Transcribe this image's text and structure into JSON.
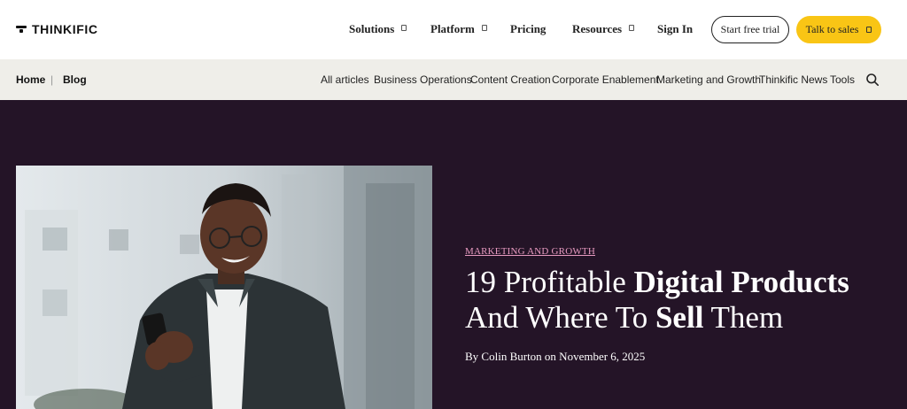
{
  "header": {
    "logo_text": "THINKIFIC",
    "nav": [
      {
        "label": "Solutions",
        "has_dropdown": true
      },
      {
        "label": "Platform",
        "has_dropdown": true
      },
      {
        "label": "Pricing",
        "has_dropdown": false
      },
      {
        "label": "Resources",
        "has_dropdown": true
      },
      {
        "label": "Sign In",
        "has_dropdown": false
      }
    ],
    "start_trial_label": "Start free trial",
    "talk_sales_label": "Talk to sales",
    "accent_color": "#f9c515"
  },
  "subnav": {
    "breadcrumb": [
      "Home",
      "Blog"
    ],
    "categories": [
      "All articles",
      "Business Operations",
      "Content Creation",
      "Corporate Enablement",
      "Marketing and Growth",
      "Thinkific News",
      "Tools"
    ],
    "search_icon": "search-icon",
    "background_color": "#efeee9"
  },
  "hero": {
    "background_color": "#241427",
    "category": "MARKETING AND GROWTH",
    "category_color": "#e79ac0",
    "title_parts": {
      "p1": "19 Profitable ",
      "b1": "Digital Products",
      "p2": "And Where To ",
      "b2": "Sell",
      "p3": " Them"
    },
    "byline": "By Colin Burton on November 6, 2025",
    "image_description": "man-smiling-at-phone-photo"
  }
}
